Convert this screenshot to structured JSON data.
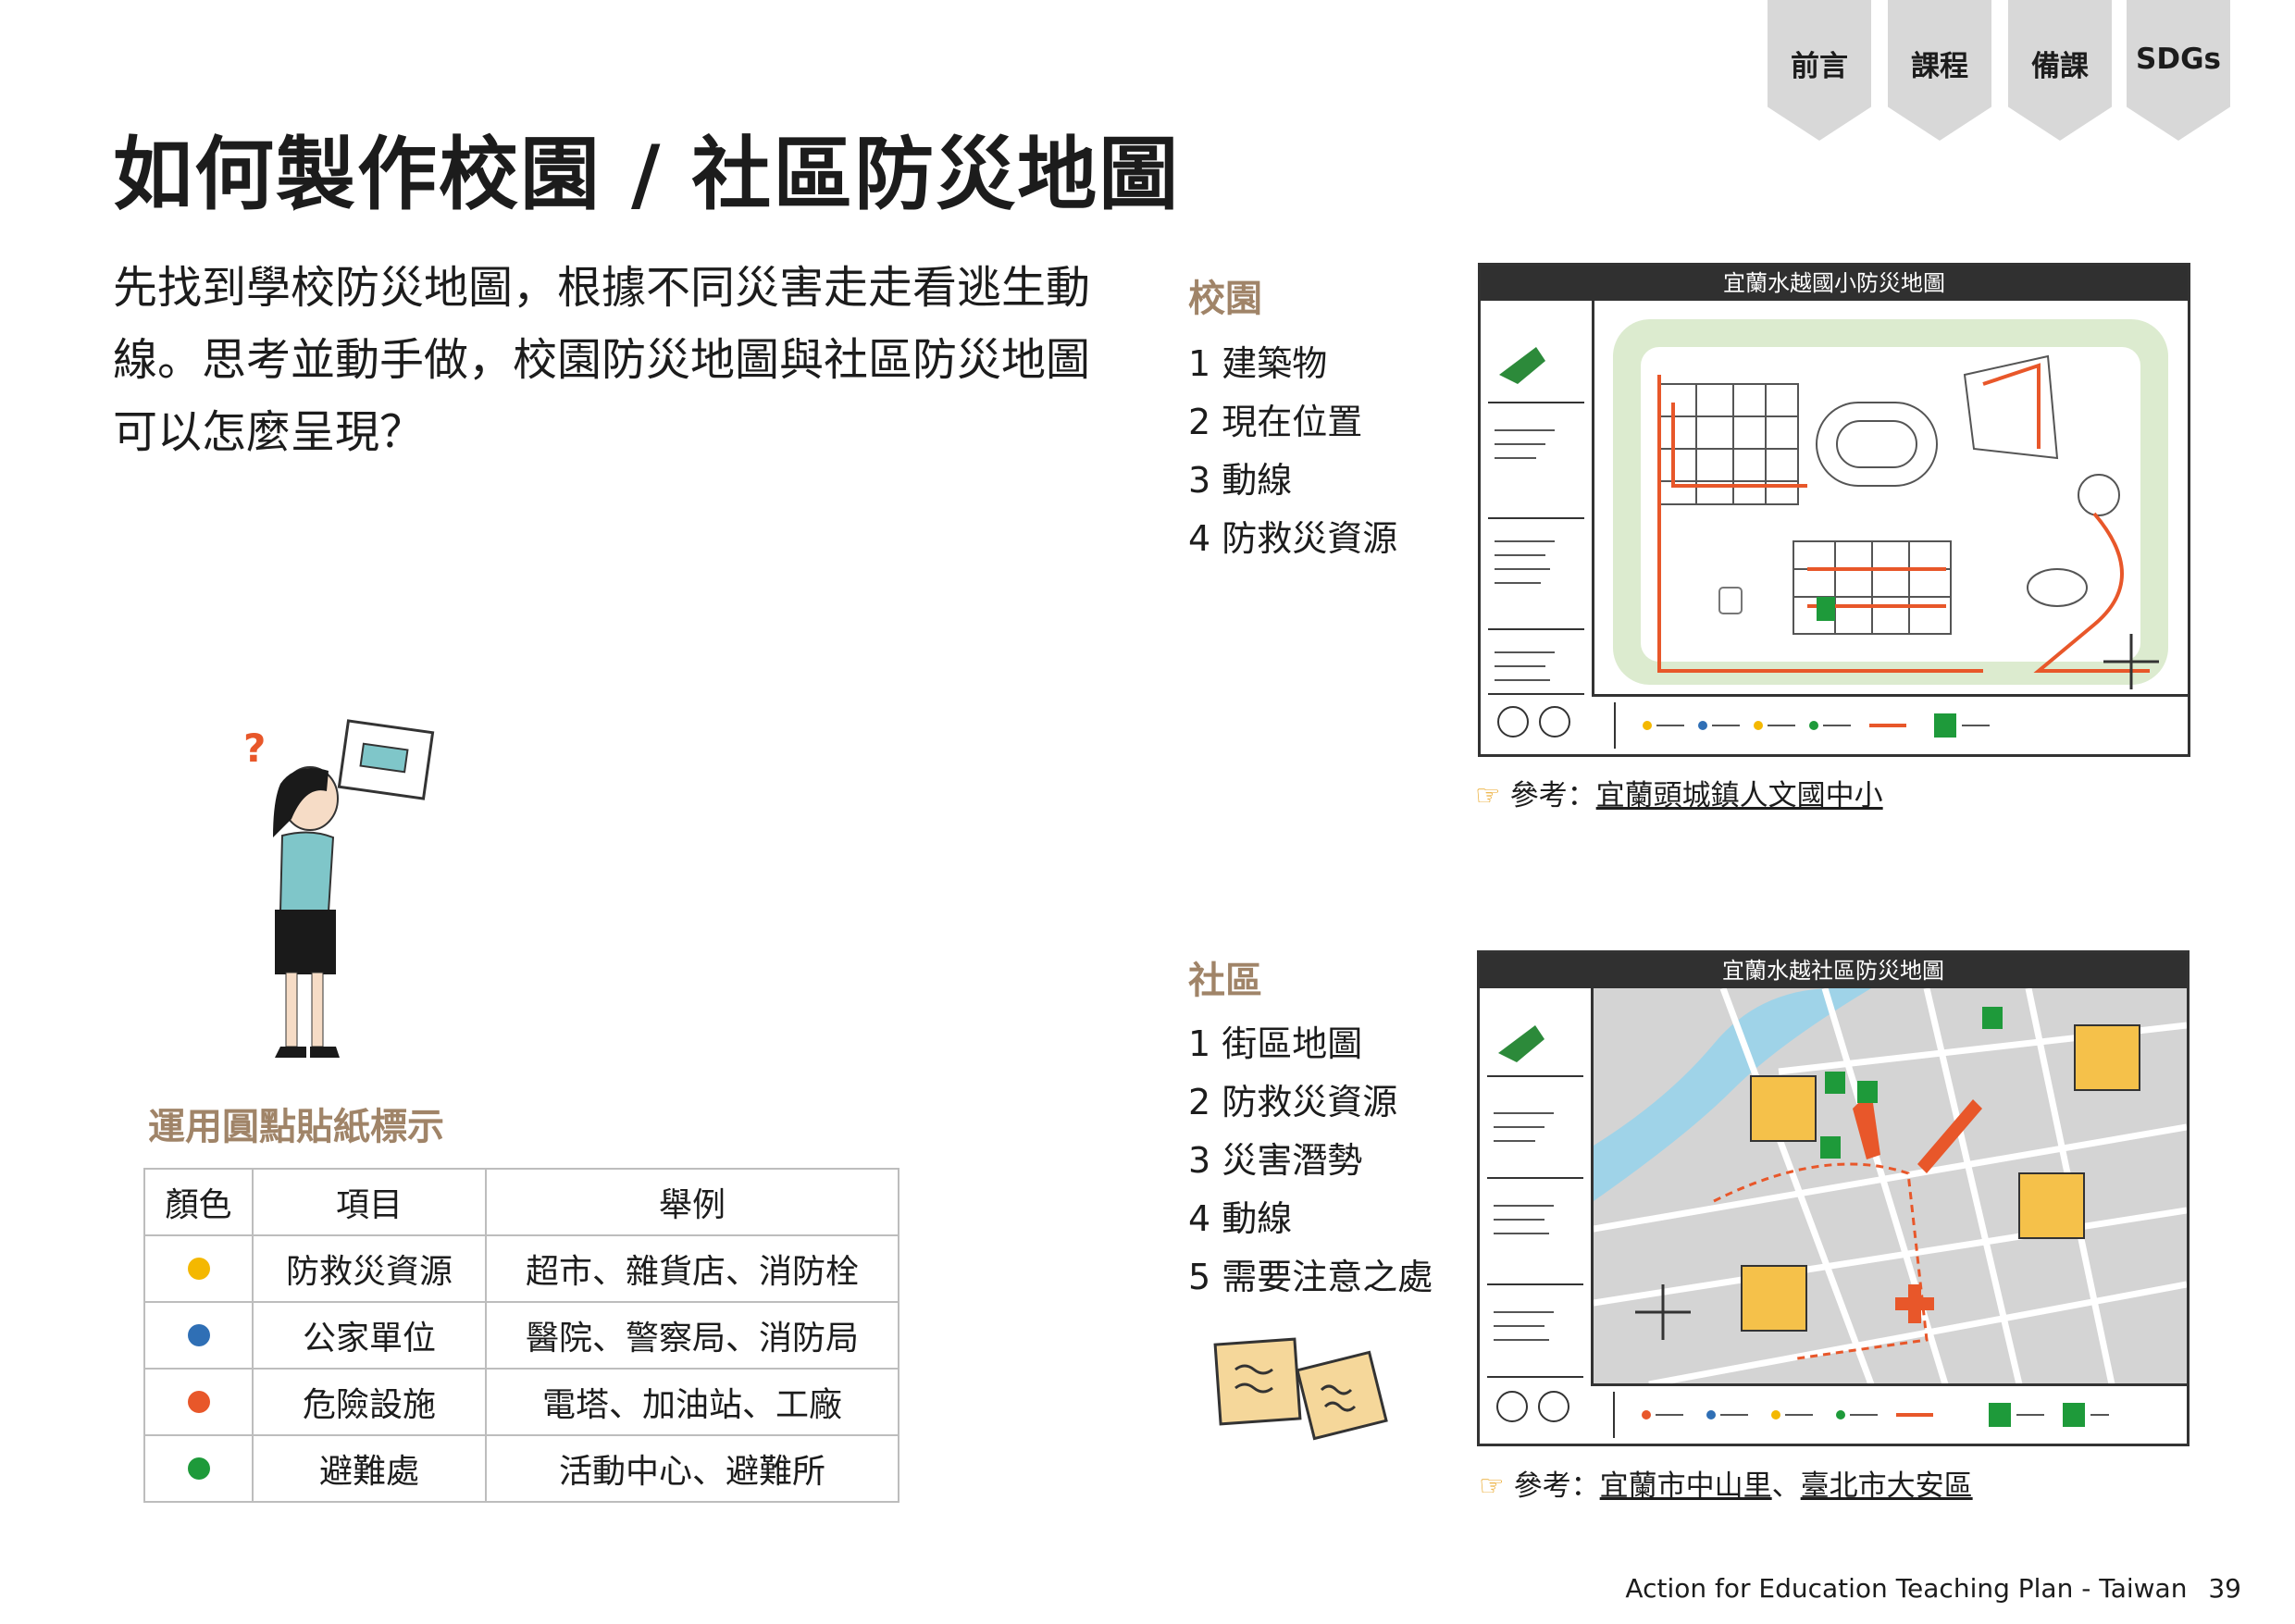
{
  "nav_tabs": [
    "前言",
    "課程",
    "備課",
    "SDGs"
  ],
  "title": "如何製作校園 / 社區防災地圖",
  "intro": "先找到學校防災地圖，根據不同災害走走看逃生動線。思考並動手做，校園防災地圖與社區防災地圖可以怎麼呈現？",
  "campus": {
    "heading": "校園",
    "items": [
      "1 建築物",
      "2 現在位置",
      "3 動線",
      "4 防救災資源"
    ],
    "map_title": "宜蘭水越國小防災地圖",
    "reference_prefix": "參考：",
    "reference": "宜蘭頭城鎮人文國中小"
  },
  "community": {
    "heading": "社區",
    "items": [
      "1 街區地圖",
      "2 防救災資源",
      "3 災害潛勢",
      "4 動線",
      "5 需要注意之處"
    ],
    "map_title": "宜蘭水越社區防災地圖",
    "reference_prefix": "參考：",
    "reference_1": "宜蘭市中山里",
    "reference_sep": "、",
    "reference_2": "臺北市大安區"
  },
  "sticker_section": {
    "heading": "運用圓點貼紙標示",
    "headers": [
      "顏色",
      "項目",
      "舉例"
    ],
    "rows": [
      {
        "color": "#f4b800",
        "item": "防救災資源",
        "example": "超市、雜貨店、消防栓"
      },
      {
        "color": "#2f6fb5",
        "item": "公家單位",
        "example": "醫院、警察局、消防局"
      },
      {
        "color": "#e8572a",
        "item": "危險設施",
        "example": "電塔、加油站、工廠"
      },
      {
        "color": "#1e9a3a",
        "item": "避難處",
        "example": "活動中心、避難所"
      }
    ]
  },
  "footer": {
    "text": "Action for Education Teaching Plan - Taiwan",
    "page": "39"
  }
}
